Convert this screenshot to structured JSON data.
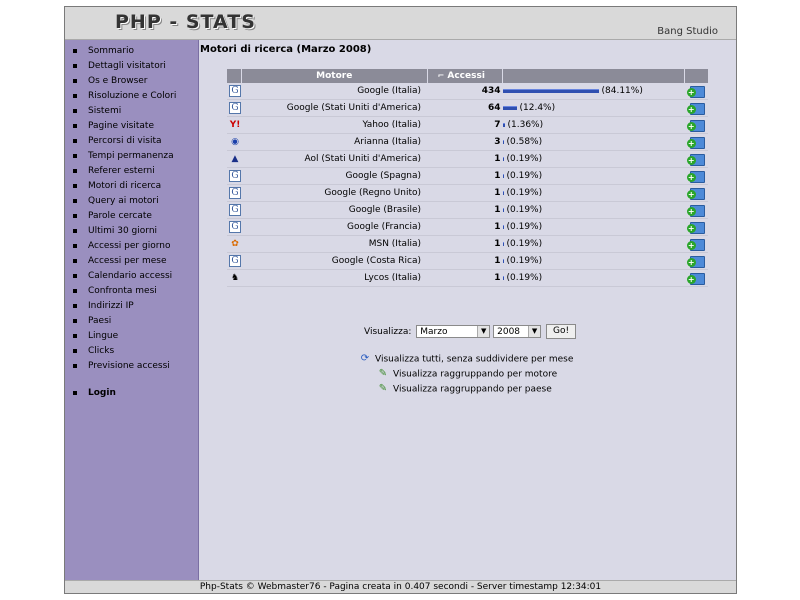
{
  "header": {
    "logo": "PHP - STATS",
    "studio": "Bang Studio"
  },
  "sidebar": {
    "items": [
      "Sommario",
      "Dettagli visitatori",
      "Os e Browser",
      "Risoluzione e Colori",
      "Sistemi",
      "Pagine visitate",
      "Percorsi di visita",
      "Tempi permanenza",
      "Referer esterni",
      "Motori di ricerca",
      "Query ai motori",
      "Parole cercate",
      "Ultimi 30 giorni",
      "Accessi per giorno",
      "Accessi per mese",
      "Calendario accessi",
      "Confronta mesi",
      "Indirizzi IP",
      "Paesi",
      "Lingue",
      "Clicks",
      "Previsione accessi"
    ],
    "login": "Login"
  },
  "main": {
    "title": "Motori di ricerca (Marzo 2008)",
    "table": {
      "col_engine": "Motore",
      "col_hits": "Accessi",
      "rows": [
        {
          "icon": "google",
          "name": "Google (Italia)",
          "hits": "434",
          "pct": "(84.11%)",
          "share": 0.8411
        },
        {
          "icon": "google",
          "name": "Google (Stati Uniti d'America)",
          "hits": "64",
          "pct": "(12.4%)",
          "share": 0.124
        },
        {
          "icon": "yahoo",
          "name": "Yahoo (Italia)",
          "hits": "7",
          "pct": "(1.36%)",
          "share": 0.0136
        },
        {
          "icon": "arianna",
          "name": "Arianna (Italia)",
          "hits": "3",
          "pct": "(0.58%)",
          "share": 0.0058
        },
        {
          "icon": "aol",
          "name": "Aol (Stati Uniti d'America)",
          "hits": "1",
          "pct": "(0.19%)",
          "share": 0.0019
        },
        {
          "icon": "google",
          "name": "Google (Spagna)",
          "hits": "1",
          "pct": "(0.19%)",
          "share": 0.0019
        },
        {
          "icon": "google",
          "name": "Google (Regno Unito)",
          "hits": "1",
          "pct": "(0.19%)",
          "share": 0.0019
        },
        {
          "icon": "google",
          "name": "Google (Brasile)",
          "hits": "1",
          "pct": "(0.19%)",
          "share": 0.0019
        },
        {
          "icon": "google",
          "name": "Google (Francia)",
          "hits": "1",
          "pct": "(0.19%)",
          "share": 0.0019
        },
        {
          "icon": "msn",
          "name": "MSN (Italia)",
          "hits": "1",
          "pct": "(0.19%)",
          "share": 0.0019
        },
        {
          "icon": "google",
          "name": "Google (Costa Rica)",
          "hits": "1",
          "pct": "(0.19%)",
          "share": 0.0019
        },
        {
          "icon": "lycos",
          "name": "Lycos (Italia)",
          "hits": "1",
          "pct": "(0.19%)",
          "share": 0.0019
        }
      ]
    },
    "view": {
      "label": "Visualizza:",
      "month": "Marzo",
      "year": "2008",
      "go": "Go!"
    },
    "links": [
      {
        "icon": "refresh-icon",
        "text": "Visualizza tutti, senza suddividere per mese"
      },
      {
        "icon": "edit-icon",
        "text": "Visualizza raggruppando per motore"
      },
      {
        "icon": "edit-icon",
        "text": "Visualizza raggruppando per paese"
      }
    ]
  },
  "footer": {
    "text": "Php-Stats © Webmaster76  - Pagina creata in 0.407 secondi  - Server timestamp 12:34:01"
  },
  "colors": {
    "sidebar": "#9a8fbf",
    "table_header": "#8b8b98",
    "bar": "#2f4fb0",
    "background": "#d9d9e6"
  }
}
